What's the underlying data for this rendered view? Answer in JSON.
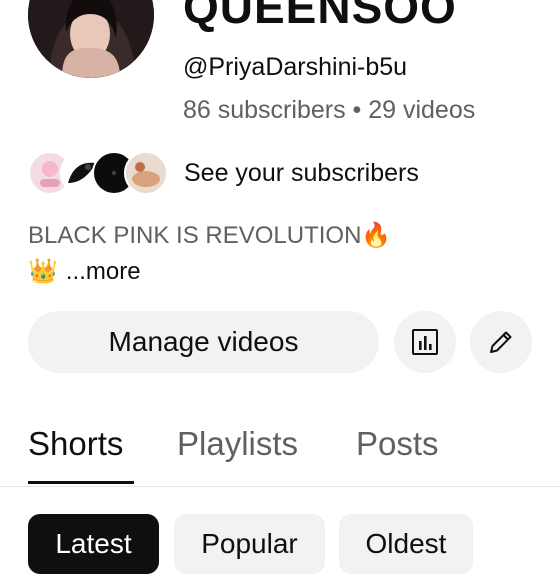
{
  "channel": {
    "title": "QUEENSOO",
    "handle": "@PriyaDarshini-b5u",
    "stats": "86 subscribers • 29 videos"
  },
  "subscribers": {
    "label": "See your subscribers"
  },
  "bio": {
    "text": "BLACK PINK IS REVOLUTION",
    "emoji": "🔥",
    "crown": "👑",
    "more": "...more"
  },
  "actions": {
    "manage_label": "Manage videos"
  },
  "tabs": [
    {
      "label": "Shorts",
      "active": true
    },
    {
      "label": "Playlists",
      "active": false
    },
    {
      "label": "Posts",
      "active": false
    }
  ],
  "chips": [
    {
      "label": "Latest",
      "selected": true
    },
    {
      "label": "Popular",
      "selected": false
    },
    {
      "label": "Oldest",
      "selected": false
    }
  ],
  "colors": {
    "text_primary": "#0f0f0f",
    "text_secondary": "#606060",
    "button_bg": "#f2f2f2",
    "chip_selected_bg": "#0f0f0f"
  },
  "icons": {
    "analytics": "bar-chart-icon",
    "edit": "pencil-icon"
  }
}
